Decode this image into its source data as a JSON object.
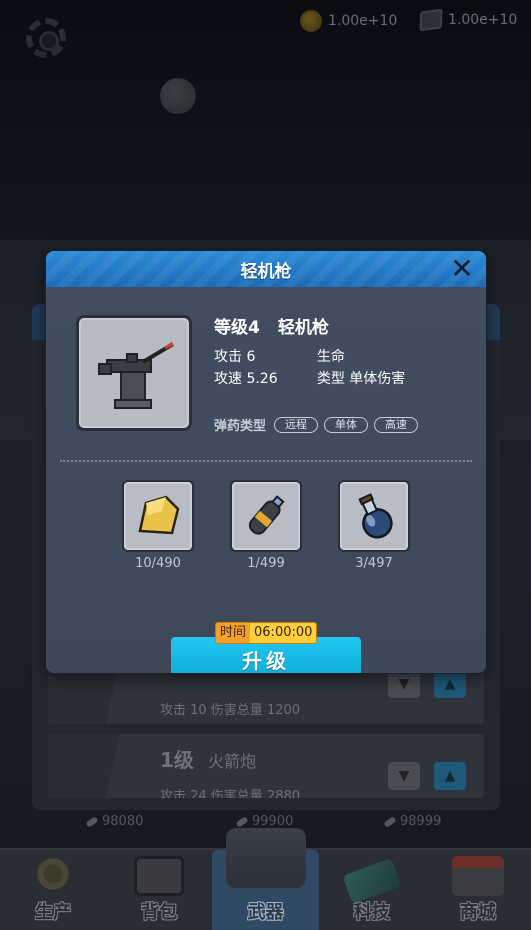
{
  "currency": {
    "coins": "1.00e+10",
    "gems": "1.00e+10"
  },
  "background_list": {
    "row1_stats": "攻击 10   伤害总量 1200",
    "row2_level": "1级",
    "row2_name": "火箭炮",
    "row2_stats": "攻击 24   伤害总量 2880",
    "down_arrow": "▼",
    "up_arrow": "▲"
  },
  "ammo_counts": [
    "98080",
    "99900",
    "98999"
  ],
  "bottom_nav": [
    {
      "label": "生产",
      "icon": "gear-icon"
    },
    {
      "label": "背包",
      "icon": "backpack-icon"
    },
    {
      "label": "武器",
      "icon": "cannon-icon"
    },
    {
      "label": "科技",
      "icon": "tech-icon"
    },
    {
      "label": "商城",
      "icon": "shop-icon"
    }
  ],
  "dialog": {
    "title": "轻机枪",
    "close": "✕",
    "level": "等级4",
    "name": "轻机枪",
    "stats": {
      "attack": "攻击 6",
      "life": "生命",
      "speed": "攻速 5.26",
      "type": "类型 单体伤害"
    },
    "ammo_label": "弹药类型",
    "ammo_tags": [
      "远程",
      "单体",
      "高速"
    ],
    "materials": [
      {
        "icon": "gold-ore-icon",
        "count": "10/490"
      },
      {
        "icon": "gas-canister-icon",
        "count": "1/499"
      },
      {
        "icon": "potion-flask-icon",
        "count": "3/497"
      }
    ],
    "timer_label": "时间",
    "timer_value": "06:00:00",
    "upgrade_label": "升级"
  },
  "colors": {
    "header_blue": "#1c6cb8",
    "upgrade_cyan": "#0fa9d9",
    "timer_orange": "#f3a12a",
    "dialog_bg": "#414b5d"
  }
}
